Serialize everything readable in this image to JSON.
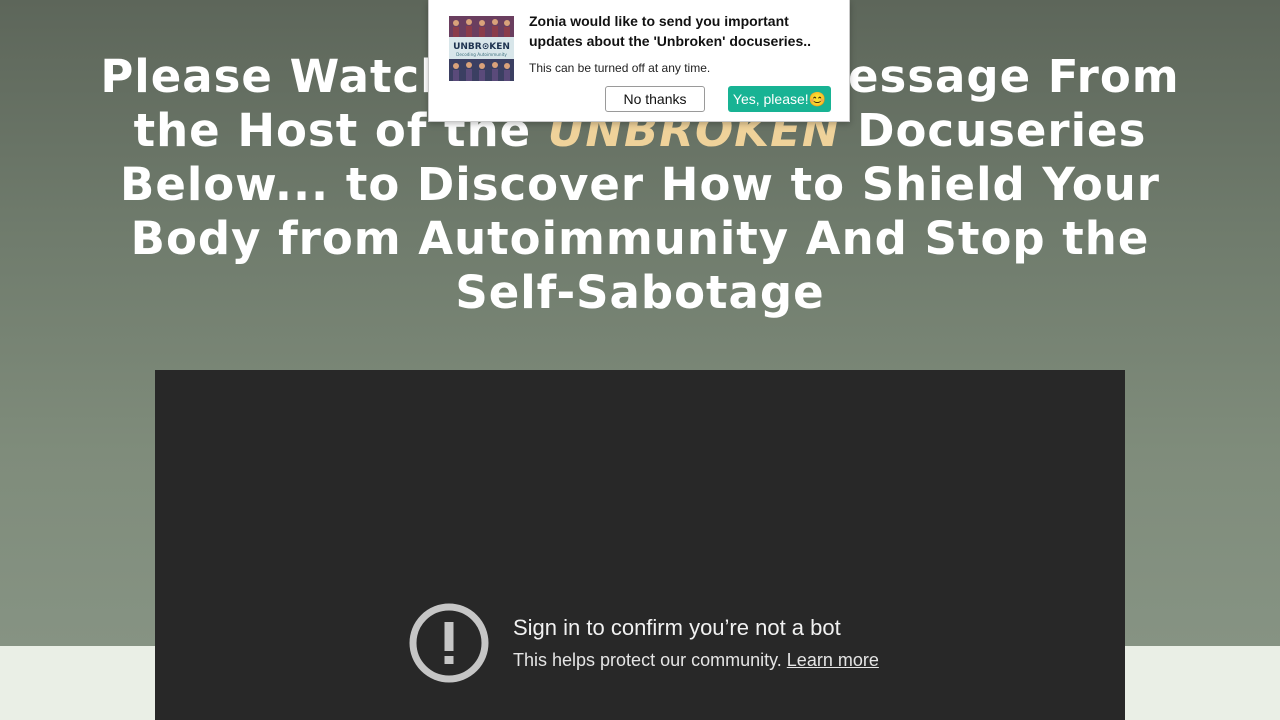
{
  "headline": {
    "before": "Please Watch This Special Message From the Host of the ",
    "accent": "UNBROKEN",
    "after": " Docuseries Below... to Discover How to Shield Your Body from Autoimmunity And Stop the Self-Sabotage"
  },
  "video": {
    "bot_title": "Sign in to confirm you’re not a bot",
    "bot_subtitle": "This helps protect our community.",
    "learn_more": "Learn more",
    "icon": "exclamation-circle-icon"
  },
  "notification": {
    "thumbnail_title": "UNBR⊙KEN",
    "thumbnail_subtitle": "Decoding Autoimmunity",
    "title": "Zonia would like to send you important updates about the 'Unbroken' docuseries..",
    "subtitle": "This can be turned off at any time.",
    "no_label": "No thanks",
    "yes_label": "Yes, please!😊"
  },
  "colors": {
    "accent": "#efd29a",
    "yes_button": "#18b394",
    "video_bg": "#282828"
  }
}
